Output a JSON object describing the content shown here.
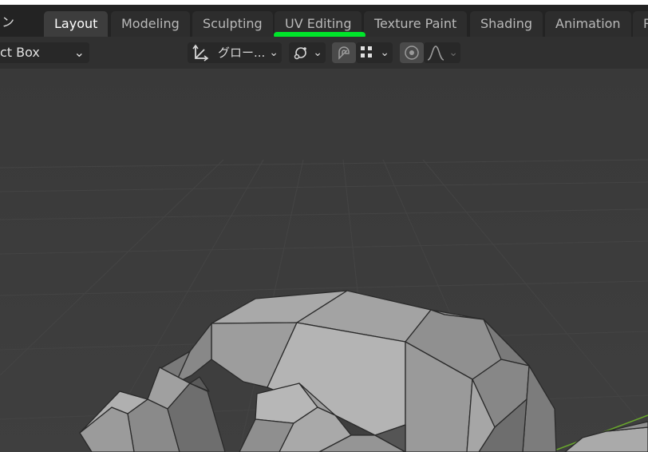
{
  "topbar": {
    "menu_fragment": "ン",
    "tabs": [
      {
        "label": "Layout"
      },
      {
        "label": "Modeling"
      },
      {
        "label": "Sculpting"
      },
      {
        "label": "UV Editing"
      },
      {
        "label": "Texture Paint"
      },
      {
        "label": "Shading"
      },
      {
        "label": "Animation"
      },
      {
        "label": "R"
      }
    ],
    "highlight_color": "#00e52a"
  },
  "header": {
    "select_mode": "ct Box",
    "transform_orientation": "グロー...",
    "chevron": "⌄"
  },
  "colors": {
    "background": "#3b3b3b",
    "topbar": "#232323",
    "active_tab": "#3d3d3d"
  }
}
